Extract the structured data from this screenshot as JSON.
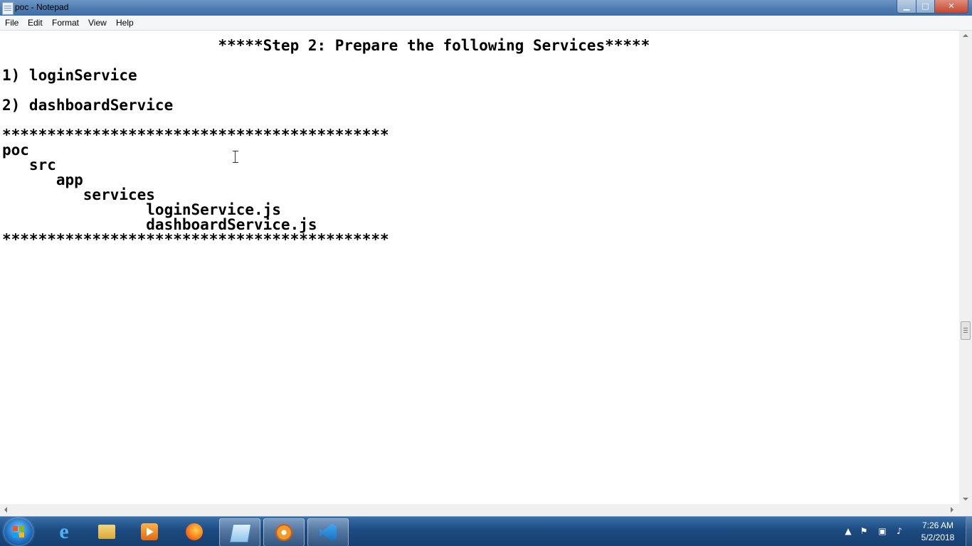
{
  "window": {
    "title": "poc - Notepad",
    "controls": {
      "minimize": "▁",
      "maximize": "□",
      "close": "✕"
    }
  },
  "menu": [
    "File",
    "Edit",
    "Format",
    "View",
    "Help"
  ],
  "document": {
    "lines": [
      "                        *****Step 2: Prepare the following Services*****",
      "",
      "1) loginService",
      "",
      "2) dashboardService",
      "",
      "*******************************************",
      "poc",
      "   src",
      "      app",
      "         services",
      "                loginService.js",
      "                dashboardService.js",
      "*******************************************"
    ]
  },
  "taskbar": {
    "pinned": [
      {
        "name": "internet-explorer",
        "icon": "ie-icon"
      },
      {
        "name": "file-explorer",
        "icon": "folder-icon"
      },
      {
        "name": "media-player",
        "icon": "media-player-icon"
      },
      {
        "name": "firefox",
        "icon": "firefox-icon"
      },
      {
        "name": "notepad",
        "icon": "notepad-icon",
        "active": true
      },
      {
        "name": "app",
        "icon": "flower-icon"
      },
      {
        "name": "visual-studio-code",
        "icon": "vscode-icon"
      }
    ],
    "tray_icons": [
      "show-hidden-icons-icon",
      "action-center-icon",
      "network-icon",
      "volume-icon"
    ],
    "clock": {
      "time": "7:26 AM",
      "date": "5/2/2018"
    }
  }
}
